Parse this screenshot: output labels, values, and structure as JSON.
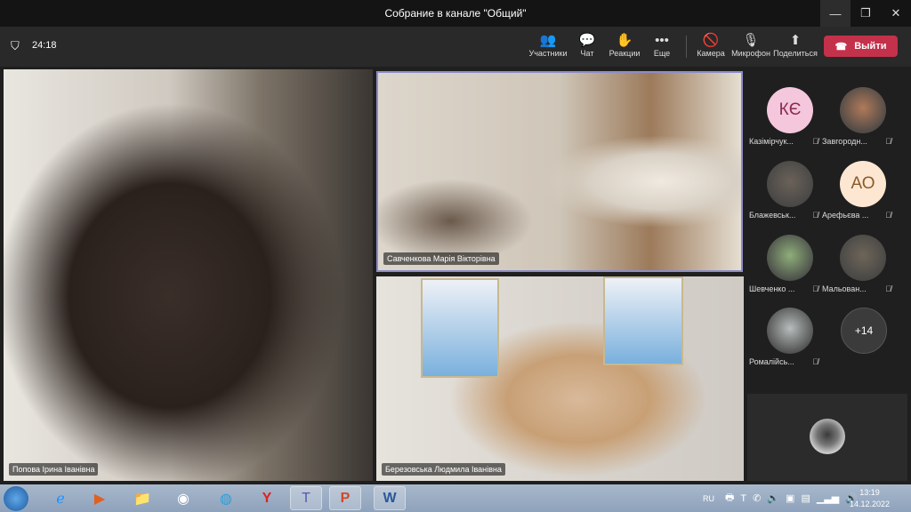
{
  "window": {
    "title": "Собрание в канале \"Общий\""
  },
  "toolbar": {
    "timer": "24:18",
    "participants": "Участники",
    "chat": "Чат",
    "reactions": "Реакции",
    "more": "Еще",
    "camera": "Камера",
    "mic": "Микрофон",
    "share": "Поделиться",
    "leave": "Выйти"
  },
  "tiles": [
    {
      "name": "Попова Ірина Іванівна"
    },
    {
      "name": "Савченкова Марія Вікторівна"
    },
    {
      "name": "Березовська Людмила Іванівна"
    }
  ],
  "panel": {
    "participants": [
      {
        "name": "Казімірчук...",
        "initials": "КЄ",
        "bg": "#f4c7dc",
        "fg": "#8b2a50"
      },
      {
        "name": "Завгородн...",
        "initials": "",
        "bg": "#b07a5a"
      },
      {
        "name": "Блажевськ...",
        "initials": "",
        "bg": "#6b6258"
      },
      {
        "name": "Арефьєва ...",
        "initials": "АО",
        "bg": "#fde7d2",
        "fg": "#8a5a2a"
      },
      {
        "name": "Шевченко ...",
        "initials": "",
        "bg": "#8fae7a"
      },
      {
        "name": "Мальован...",
        "initials": "",
        "bg": "#6e6558"
      },
      {
        "name": "Ромалійсь...",
        "initials": "",
        "bg": "#b8bcbc"
      }
    ],
    "overflow": "+14"
  },
  "taskbar": {
    "lang": "RU",
    "time": "13:19",
    "date": "14.12.2022"
  }
}
